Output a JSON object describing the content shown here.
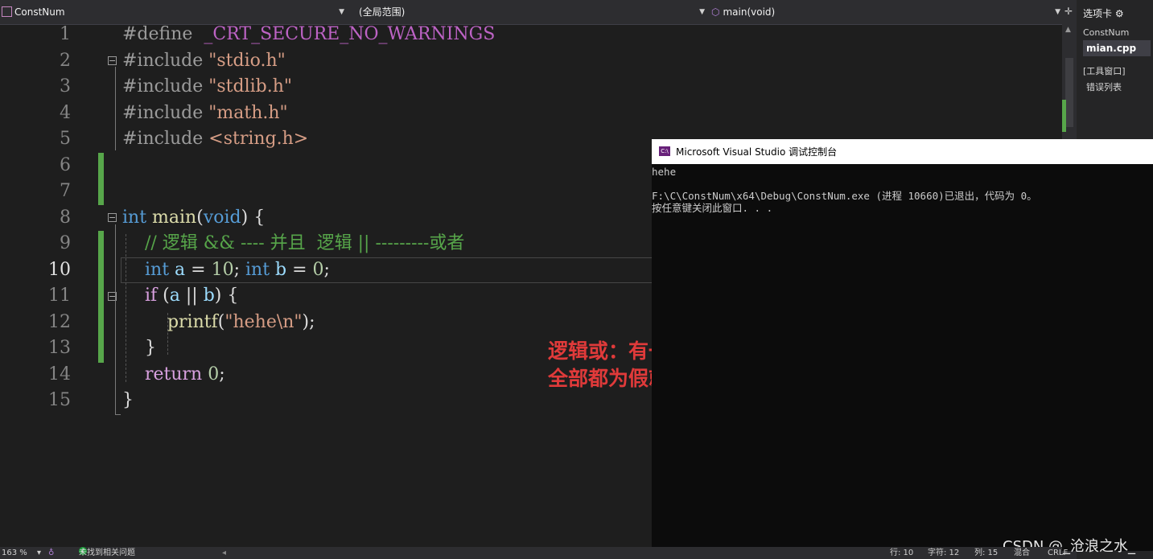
{
  "nav": {
    "file_combo": "ConstNum",
    "scope_combo": "(全局范围)",
    "func_combo": "main(void)"
  },
  "right_panel": {
    "tab_label": "选项卡",
    "project": "ConstNum",
    "file": "mian.cpp",
    "tool_window": "[工具窗口]",
    "error_list": "错误列表"
  },
  "editor": {
    "current_line": 10,
    "lines": [
      {
        "n": "1",
        "tokens": [
          {
            "t": "#define  ",
            "c": "pp"
          },
          {
            "t": "_CRT_SECURE_NO_WARNINGS",
            "c": "macro"
          }
        ]
      },
      {
        "n": "2",
        "tokens": [
          {
            "t": "#include ",
            "c": "pp"
          },
          {
            "t": "\"stdio.h\"",
            "c": "str"
          }
        ]
      },
      {
        "n": "3",
        "tokens": [
          {
            "t": "#include ",
            "c": "pp"
          },
          {
            "t": "\"stdlib.h\"",
            "c": "str"
          }
        ]
      },
      {
        "n": "4",
        "tokens": [
          {
            "t": "#include ",
            "c": "pp"
          },
          {
            "t": "\"math.h\"",
            "c": "str"
          }
        ]
      },
      {
        "n": "5",
        "tokens": [
          {
            "t": "#include ",
            "c": "pp"
          },
          {
            "t": "<string.h>",
            "c": "str"
          }
        ]
      },
      {
        "n": "6",
        "tokens": []
      },
      {
        "n": "7",
        "tokens": []
      },
      {
        "n": "8",
        "tokens": [
          {
            "t": "int",
            "c": "kw"
          },
          {
            "t": " ",
            "c": "txt"
          },
          {
            "t": "main",
            "c": "fn"
          },
          {
            "t": "(",
            "c": "txt"
          },
          {
            "t": "void",
            "c": "kw"
          },
          {
            "t": ") {",
            "c": "txt"
          }
        ]
      },
      {
        "n": "9",
        "tokens": [
          {
            "t": "    // 逻辑 && ---- 并且  逻辑 || ---------或者",
            "c": "cm"
          }
        ]
      },
      {
        "n": "10",
        "tokens": [
          {
            "t": "    ",
            "c": "txt"
          },
          {
            "t": "int",
            "c": "kw"
          },
          {
            "t": " ",
            "c": "txt"
          },
          {
            "t": "a",
            "c": "var"
          },
          {
            "t": " = ",
            "c": "txt"
          },
          {
            "t": "10",
            "c": "num"
          },
          {
            "t": "; ",
            "c": "txt"
          },
          {
            "t": "int",
            "c": "kw"
          },
          {
            "t": " ",
            "c": "txt"
          },
          {
            "t": "b",
            "c": "var"
          },
          {
            "t": " = ",
            "c": "txt"
          },
          {
            "t": "0",
            "c": "num"
          },
          {
            "t": ";",
            "c": "txt"
          }
        ]
      },
      {
        "n": "11",
        "tokens": [
          {
            "t": "    ",
            "c": "txt"
          },
          {
            "t": "if",
            "c": "ctrl"
          },
          {
            "t": " (",
            "c": "txt"
          },
          {
            "t": "a",
            "c": "var"
          },
          {
            "t": " || ",
            "c": "txt"
          },
          {
            "t": "b",
            "c": "var"
          },
          {
            "t": ") {",
            "c": "txt"
          }
        ]
      },
      {
        "n": "12",
        "tokens": [
          {
            "t": "        ",
            "c": "txt"
          },
          {
            "t": "printf",
            "c": "fn"
          },
          {
            "t": "(",
            "c": "txt"
          },
          {
            "t": "\"hehe\\n\"",
            "c": "str"
          },
          {
            "t": ");",
            "c": "txt"
          }
        ]
      },
      {
        "n": "13",
        "tokens": [
          {
            "t": "    }",
            "c": "txt"
          }
        ]
      },
      {
        "n": "14",
        "tokens": [
          {
            "t": "    ",
            "c": "txt"
          },
          {
            "t": "return",
            "c": "ctrl"
          },
          {
            "t": " ",
            "c": "txt"
          },
          {
            "t": "0",
            "c": "num"
          },
          {
            "t": ";",
            "c": "txt"
          }
        ]
      },
      {
        "n": "15",
        "tokens": [
          {
            "t": "}",
            "c": "txt"
          }
        ]
      }
    ]
  },
  "annotation": {
    "line1": "逻辑或：有一个为真就是真",
    "line2": "全部都为假就是假"
  },
  "console": {
    "title": "Microsoft Visual Studio 调试控制台",
    "icon_text": "C:\\",
    "output": [
      "hehe",
      "",
      "F:\\C\\ConstNum\\x64\\Debug\\ConstNum.exe (进程 10660)已退出，代码为 0。",
      "按任意键关闭此窗口. . ."
    ]
  },
  "status": {
    "zoom": "163 %",
    "issues": "未找到相关问题",
    "row": "行: 10",
    "char": "字符: 12",
    "col": "列: 15",
    "tabs": "混合",
    "eol": "CRLF"
  },
  "watermark": "CSDN @_沧浪之水_",
  "colors": {
    "editor_bg": "#1e1e1e",
    "keyword": "#569cd6",
    "string": "#d69d85",
    "comment": "#57a64a",
    "macro": "#bd63c5",
    "annotation": "#e03a3a"
  }
}
